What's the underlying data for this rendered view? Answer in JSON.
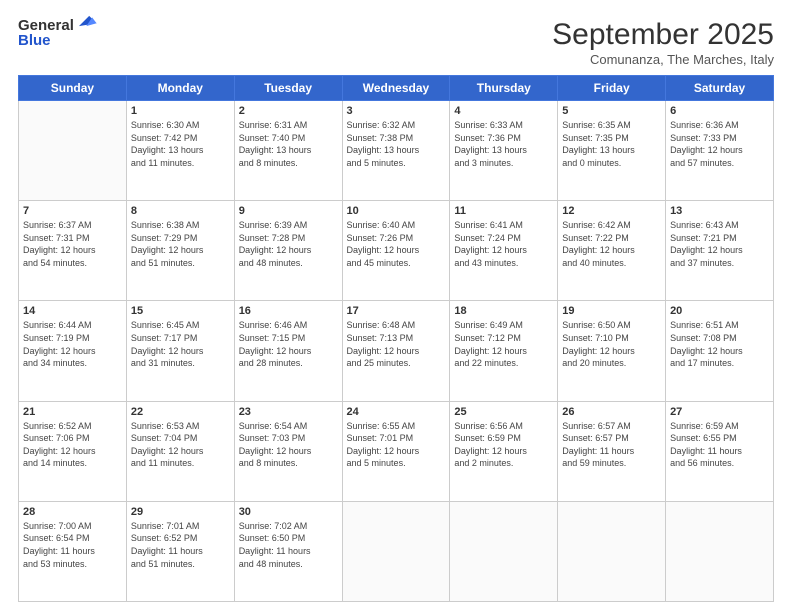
{
  "logo": {
    "general": "General",
    "blue": "Blue"
  },
  "header": {
    "month": "September 2025",
    "location": "Comunanza, The Marches, Italy"
  },
  "days_of_week": [
    "Sunday",
    "Monday",
    "Tuesday",
    "Wednesday",
    "Thursday",
    "Friday",
    "Saturday"
  ],
  "weeks": [
    [
      {
        "day": "",
        "info": ""
      },
      {
        "day": "1",
        "info": "Sunrise: 6:30 AM\nSunset: 7:42 PM\nDaylight: 13 hours\nand 11 minutes."
      },
      {
        "day": "2",
        "info": "Sunrise: 6:31 AM\nSunset: 7:40 PM\nDaylight: 13 hours\nand 8 minutes."
      },
      {
        "day": "3",
        "info": "Sunrise: 6:32 AM\nSunset: 7:38 PM\nDaylight: 13 hours\nand 5 minutes."
      },
      {
        "day": "4",
        "info": "Sunrise: 6:33 AM\nSunset: 7:36 PM\nDaylight: 13 hours\nand 3 minutes."
      },
      {
        "day": "5",
        "info": "Sunrise: 6:35 AM\nSunset: 7:35 PM\nDaylight: 13 hours\nand 0 minutes."
      },
      {
        "day": "6",
        "info": "Sunrise: 6:36 AM\nSunset: 7:33 PM\nDaylight: 12 hours\nand 57 minutes."
      }
    ],
    [
      {
        "day": "7",
        "info": "Sunrise: 6:37 AM\nSunset: 7:31 PM\nDaylight: 12 hours\nand 54 minutes."
      },
      {
        "day": "8",
        "info": "Sunrise: 6:38 AM\nSunset: 7:29 PM\nDaylight: 12 hours\nand 51 minutes."
      },
      {
        "day": "9",
        "info": "Sunrise: 6:39 AM\nSunset: 7:28 PM\nDaylight: 12 hours\nand 48 minutes."
      },
      {
        "day": "10",
        "info": "Sunrise: 6:40 AM\nSunset: 7:26 PM\nDaylight: 12 hours\nand 45 minutes."
      },
      {
        "day": "11",
        "info": "Sunrise: 6:41 AM\nSunset: 7:24 PM\nDaylight: 12 hours\nand 43 minutes."
      },
      {
        "day": "12",
        "info": "Sunrise: 6:42 AM\nSunset: 7:22 PM\nDaylight: 12 hours\nand 40 minutes."
      },
      {
        "day": "13",
        "info": "Sunrise: 6:43 AM\nSunset: 7:21 PM\nDaylight: 12 hours\nand 37 minutes."
      }
    ],
    [
      {
        "day": "14",
        "info": "Sunrise: 6:44 AM\nSunset: 7:19 PM\nDaylight: 12 hours\nand 34 minutes."
      },
      {
        "day": "15",
        "info": "Sunrise: 6:45 AM\nSunset: 7:17 PM\nDaylight: 12 hours\nand 31 minutes."
      },
      {
        "day": "16",
        "info": "Sunrise: 6:46 AM\nSunset: 7:15 PM\nDaylight: 12 hours\nand 28 minutes."
      },
      {
        "day": "17",
        "info": "Sunrise: 6:48 AM\nSunset: 7:13 PM\nDaylight: 12 hours\nand 25 minutes."
      },
      {
        "day": "18",
        "info": "Sunrise: 6:49 AM\nSunset: 7:12 PM\nDaylight: 12 hours\nand 22 minutes."
      },
      {
        "day": "19",
        "info": "Sunrise: 6:50 AM\nSunset: 7:10 PM\nDaylight: 12 hours\nand 20 minutes."
      },
      {
        "day": "20",
        "info": "Sunrise: 6:51 AM\nSunset: 7:08 PM\nDaylight: 12 hours\nand 17 minutes."
      }
    ],
    [
      {
        "day": "21",
        "info": "Sunrise: 6:52 AM\nSunset: 7:06 PM\nDaylight: 12 hours\nand 14 minutes."
      },
      {
        "day": "22",
        "info": "Sunrise: 6:53 AM\nSunset: 7:04 PM\nDaylight: 12 hours\nand 11 minutes."
      },
      {
        "day": "23",
        "info": "Sunrise: 6:54 AM\nSunset: 7:03 PM\nDaylight: 12 hours\nand 8 minutes."
      },
      {
        "day": "24",
        "info": "Sunrise: 6:55 AM\nSunset: 7:01 PM\nDaylight: 12 hours\nand 5 minutes."
      },
      {
        "day": "25",
        "info": "Sunrise: 6:56 AM\nSunset: 6:59 PM\nDaylight: 12 hours\nand 2 minutes."
      },
      {
        "day": "26",
        "info": "Sunrise: 6:57 AM\nSunset: 6:57 PM\nDaylight: 11 hours\nand 59 minutes."
      },
      {
        "day": "27",
        "info": "Sunrise: 6:59 AM\nSunset: 6:55 PM\nDaylight: 11 hours\nand 56 minutes."
      }
    ],
    [
      {
        "day": "28",
        "info": "Sunrise: 7:00 AM\nSunset: 6:54 PM\nDaylight: 11 hours\nand 53 minutes."
      },
      {
        "day": "29",
        "info": "Sunrise: 7:01 AM\nSunset: 6:52 PM\nDaylight: 11 hours\nand 51 minutes."
      },
      {
        "day": "30",
        "info": "Sunrise: 7:02 AM\nSunset: 6:50 PM\nDaylight: 11 hours\nand 48 minutes."
      },
      {
        "day": "",
        "info": ""
      },
      {
        "day": "",
        "info": ""
      },
      {
        "day": "",
        "info": ""
      },
      {
        "day": "",
        "info": ""
      }
    ]
  ]
}
